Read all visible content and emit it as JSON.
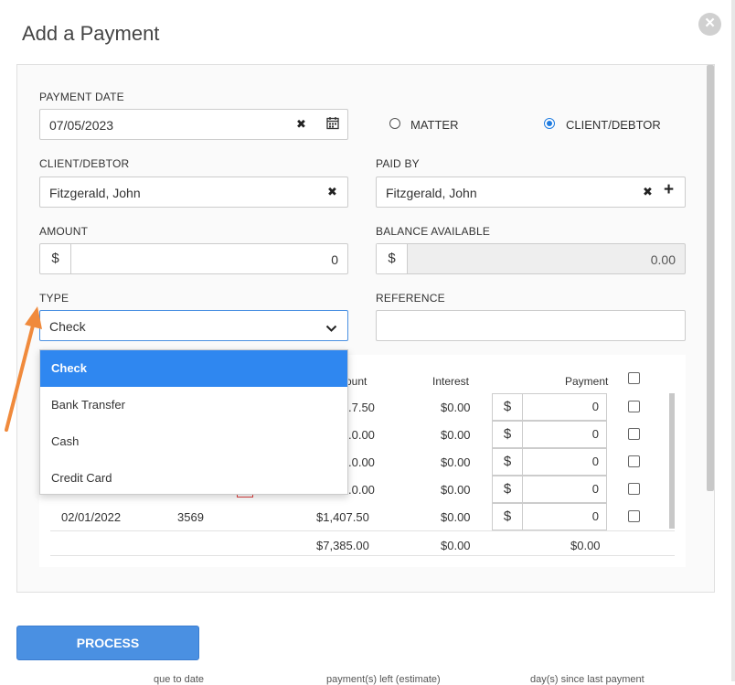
{
  "modal": {
    "title": "Add a Payment",
    "close_glyph": "×"
  },
  "form": {
    "payment_date": {
      "label": "PAYMENT DATE",
      "value": "07/05/2023"
    },
    "radios": [
      {
        "label": "MATTER",
        "checked": false
      },
      {
        "label": "CLIENT/DEBTOR",
        "checked": true
      }
    ],
    "client_debtor": {
      "label": "CLIENT/DEBTOR",
      "value": "Fitzgerald, John"
    },
    "paid_by": {
      "label": "PAID BY",
      "value": "Fitzgerald, John"
    },
    "amount": {
      "label": "AMOUNT",
      "currency": "$",
      "value": "0"
    },
    "balance_available": {
      "label": "BALANCE AVAILABLE",
      "currency": "$",
      "value": "0.00"
    },
    "type": {
      "label": "TYPE",
      "value": "Check"
    },
    "reference": {
      "label": "REFERENCE",
      "value": ""
    }
  },
  "type_dropdown": {
    "options": [
      "Check",
      "Bank Transfer",
      "Cash",
      "Credit Card"
    ],
    "selected": "Check"
  },
  "table": {
    "headers": {
      "amount": "ount",
      "interest": "Interest",
      "payment": "Payment"
    },
    "rows": [
      {
        "date": "",
        "ref": "",
        "amount": ".7.50",
        "interest": "$0.00",
        "currency": "$",
        "payment": "0"
      },
      {
        "date": "",
        "ref": "",
        "amount": ".0.00",
        "interest": "$0.00",
        "currency": "$",
        "payment": "0"
      },
      {
        "date": "",
        "ref": "",
        "amount": ".0.00",
        "interest": "$0.00",
        "currency": "$",
        "payment": "0"
      },
      {
        "date": "",
        "ref": "",
        "amount": ".0.00",
        "interest": "$0.00",
        "currency": "$",
        "payment": "0"
      },
      {
        "date": "02/01/2022",
        "ref": "3569",
        "amount": "$1,407.50",
        "interest": "$0.00",
        "currency": "$",
        "payment": "0"
      }
    ],
    "totals": {
      "amount": "$7,385.00",
      "interest": "$0.00",
      "payment": "$0.00"
    }
  },
  "process_button": {
    "label": "PROCESS"
  },
  "background_text": [
    "que to date",
    "payment(s) left (estimate)",
    "day(s) since last payment"
  ],
  "colors": {
    "accent": "#2f87f0",
    "button": "#4a90e2",
    "arrow": "#f08a3c"
  }
}
